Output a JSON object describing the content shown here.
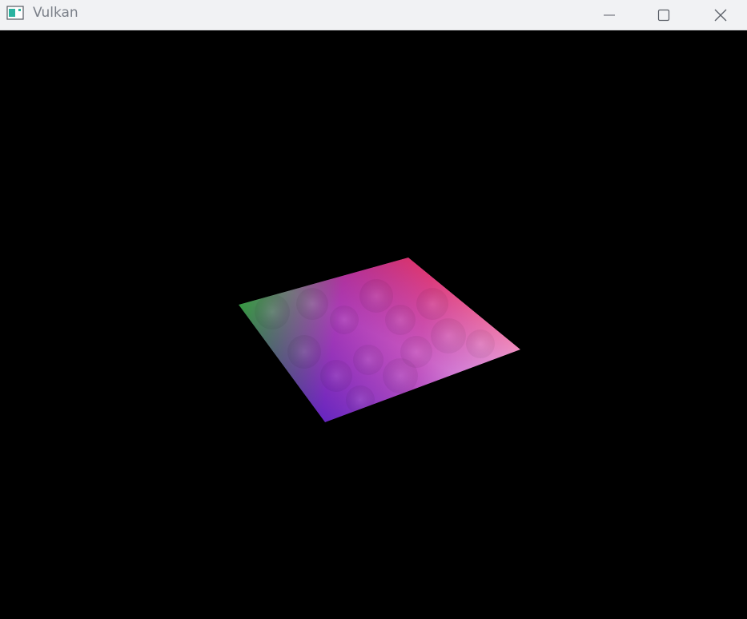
{
  "window": {
    "title": "Vulkan",
    "icon": "app-window-icon",
    "controls": {
      "minimize_icon": "minimize-icon",
      "maximize_icon": "maximize-icon",
      "close_icon": "close-icon"
    }
  },
  "scene": {
    "background": "#000000",
    "quad_corner_colors": {
      "left": "#42f542",
      "top": "#ff1f4a",
      "right": "#ffffff",
      "bottom": "#3b1aff"
    }
  }
}
